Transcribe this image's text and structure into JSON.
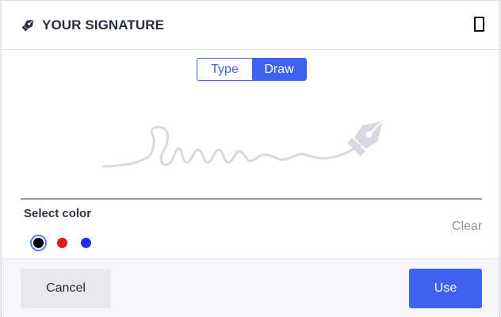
{
  "dialog": {
    "title": "YOUR SIGNATURE",
    "header_icon": "pen-nib-icon",
    "close_icon": "close-icon"
  },
  "tabs": {
    "items": [
      {
        "label": "Type",
        "active": false
      },
      {
        "label": "Draw",
        "active": true
      }
    ]
  },
  "signature": {
    "placeholder_icon": "pen-nib-icon"
  },
  "color_picker": {
    "label": "Select color",
    "clear_label": "Clear",
    "colors": [
      {
        "name": "black",
        "hex": "#000000",
        "selected": true
      },
      {
        "name": "red",
        "hex": "#e01b1b",
        "selected": false
      },
      {
        "name": "blue",
        "hex": "#1a2ff0",
        "selected": false
      }
    ]
  },
  "footer": {
    "cancel_label": "Cancel",
    "use_label": "Use"
  },
  "colors": {
    "accent": "#3f62f0",
    "baseline": "#9a9ca3",
    "signature_placeholder": "#d7d8e2"
  }
}
